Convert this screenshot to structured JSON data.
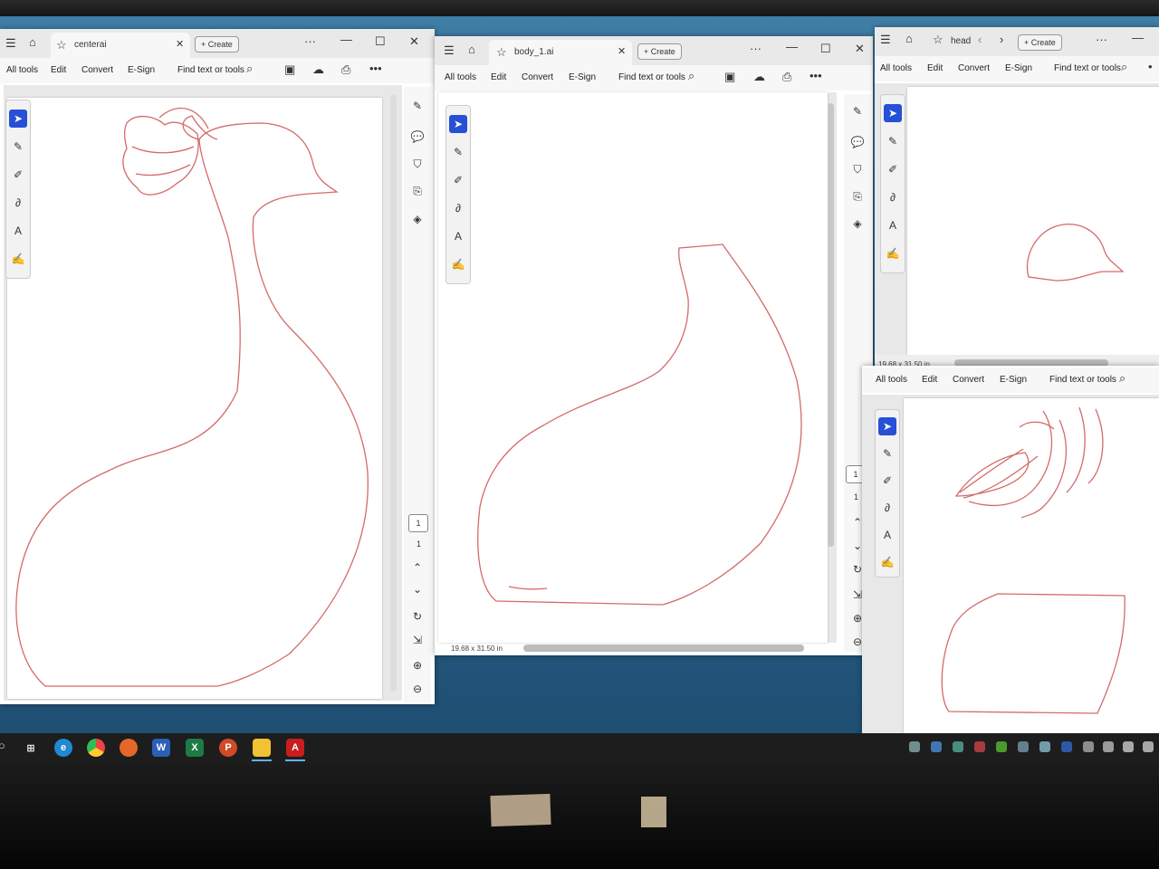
{
  "taskbar": {
    "apps": [
      "task-view",
      "edge",
      "chrome",
      "firefox",
      "W",
      "X",
      "P",
      "file-explorer",
      "acrobat"
    ]
  },
  "windows": {
    "centerai": {
      "tab_title": "centerai",
      "create_label": "Create",
      "menu": [
        "All tools",
        "Edit",
        "Convert",
        "E-Sign"
      ],
      "find_label": "Find text or tools",
      "page_box": "1",
      "page_total": "1"
    },
    "body": {
      "tab_title": "body_1.ai",
      "create_label": "Create",
      "menu": [
        "All tools",
        "Edit",
        "Convert",
        "E-Sign"
      ],
      "find_label": "Find text or tools",
      "page_box": "1",
      "page_total": "1",
      "page_size": "19.68 x 31.50 in"
    },
    "head": {
      "tab_title": "head",
      "create_label": "Create",
      "menu": [
        "All tools",
        "Edit",
        "Convert",
        "E-Sign"
      ],
      "find_label": "Find text or tools",
      "page_size": "19.68 x 31.50 in"
    },
    "fourth": {
      "menu": [
        "All tools",
        "Edit",
        "Convert",
        "E-Sign"
      ],
      "find_label": "Find text or tools"
    }
  },
  "colors": {
    "outline": "#d46a6a",
    "selected_tool": "#2650d6"
  }
}
